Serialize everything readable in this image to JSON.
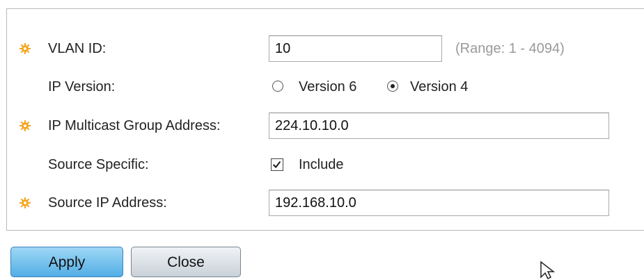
{
  "form": {
    "vlan_id": {
      "label": "VLAN ID:",
      "value": "10",
      "hint": "(Range: 1 - 4094)"
    },
    "ip_version": {
      "label": "IP Version:",
      "options": [
        {
          "label": "Version 6",
          "selected": false
        },
        {
          "label": "Version 4",
          "selected": true
        }
      ]
    },
    "multicast_group": {
      "label": "IP Multicast Group Address:",
      "value": "224.10.10.0"
    },
    "source_specific": {
      "label": "Source Specific:",
      "checkbox_label": "Include",
      "checked": true
    },
    "source_ip": {
      "label": "Source IP Address:",
      "value": "192.168.10.0"
    }
  },
  "buttons": {
    "apply": "Apply",
    "close": "Close"
  },
  "icons": {
    "required": "gear-icon",
    "cursor": "arrow-cursor-icon"
  },
  "colors": {
    "required_icon": "#f5a623",
    "apply_button": "#52aee6",
    "hint_text": "#9a9a9a"
  }
}
